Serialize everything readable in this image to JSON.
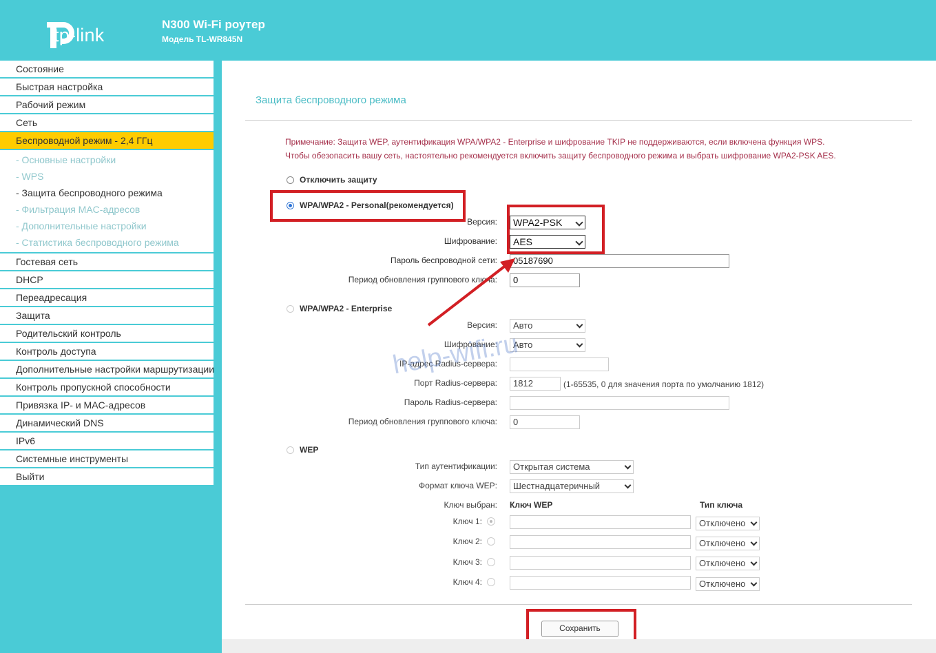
{
  "header": {
    "logo_text": "tp-link",
    "title": "N300 Wi-Fi роутер",
    "subtitle": "Модель TL-WR845N"
  },
  "sidebar": {
    "items_top": [
      {
        "label": "Состояние"
      },
      {
        "label": "Быстрая настройка"
      },
      {
        "label": "Рабочий режим"
      },
      {
        "label": "Сеть"
      },
      {
        "label": "Беспроводной режим - 2,4 ГГц"
      }
    ],
    "subitems": [
      {
        "label": "- Основные настройки"
      },
      {
        "label": "- WPS"
      },
      {
        "label": "- Защита беспроводного режима"
      },
      {
        "label": "- Фильтрация MAC-адресов"
      },
      {
        "label": "- Дополнительные настройки"
      },
      {
        "label": "- Статистика беспроводного режима"
      }
    ],
    "items_bottom": [
      {
        "label": "Гостевая сеть"
      },
      {
        "label": "DHCP"
      },
      {
        "label": "Переадресация"
      },
      {
        "label": "Защита"
      },
      {
        "label": "Родительский контроль"
      },
      {
        "label": "Контроль доступа"
      },
      {
        "label": "Дополнительные настройки маршрутизации"
      },
      {
        "label": "Контроль пропускной способности"
      },
      {
        "label": "Привязка IP- и MAC-адресов"
      },
      {
        "label": "Динамический DNS"
      },
      {
        "label": "IPv6"
      },
      {
        "label": "Системные инструменты"
      },
      {
        "label": "Выйти"
      }
    ]
  },
  "main": {
    "page_title": "Защита беспроводного режима",
    "note_line1": "Примечание: Защита WEP, аутентификация WPA/WPA2 - Enterprise и шифрование TKIP не поддерживаются, если включена функция WPS.",
    "note_line2": "Чтобы обезопасить вашу сеть, настоятельно рекомендуется включить защиту беспроводного режима и выбрать шифрование WPA2-PSK AES.",
    "disable_label": "Отключить защиту",
    "personal": {
      "label": "WPA/WPA2 - Personal(рекомендуется)",
      "version_label": "Версия:",
      "version_value": "WPA2-PSK",
      "encryption_label": "Шифрование:",
      "encryption_value": "AES",
      "password_label": "Пароль беспроводной сети:",
      "password_value": "05187690",
      "group_key_label": "Период обновления группового ключа:",
      "group_key_value": "0"
    },
    "enterprise": {
      "label": "WPA/WPA2 - Enterprise",
      "version_label": "Версия:",
      "version_value": "Авто",
      "encryption_label": "Шифрование:",
      "encryption_value": "Авто",
      "radius_ip_label": "IP-адрес Radius-сервера:",
      "radius_ip_value": "",
      "radius_port_label": "Порт Radius-сервера:",
      "radius_port_value": "1812",
      "radius_port_hint": "(1-65535, 0 для значения порта по умолчанию 1812)",
      "radius_password_label": "Пароль Radius-сервера:",
      "radius_password_value": "",
      "group_key_label": "Период обновления группового ключа:",
      "group_key_value": "0"
    },
    "wep": {
      "label": "WEP",
      "auth_type_label": "Тип аутентификации:",
      "auth_type_value": "Открытая система",
      "key_format_label": "Формат ключа WEP:",
      "key_format_value": "Шестнадцатеричный",
      "key_selected_label": "Ключ выбран:",
      "key_col_label": "Ключ WEP",
      "key_type_col_label": "Тип ключа",
      "keys": [
        {
          "label": "Ключ 1:",
          "value": "",
          "type": "Отключено"
        },
        {
          "label": "Ключ 2:",
          "value": "",
          "type": "Отключено"
        },
        {
          "label": "Ключ 3:",
          "value": "",
          "type": "Отключено"
        },
        {
          "label": "Ключ 4:",
          "value": "",
          "type": "Отключено"
        }
      ]
    },
    "save_label": "Сохранить",
    "watermark": "help-wifi.ru"
  },
  "colors": {
    "brand": "#4acbd6",
    "active_menu": "#ffcc00",
    "highlight": "#d21f24",
    "note": "#a5304b"
  }
}
